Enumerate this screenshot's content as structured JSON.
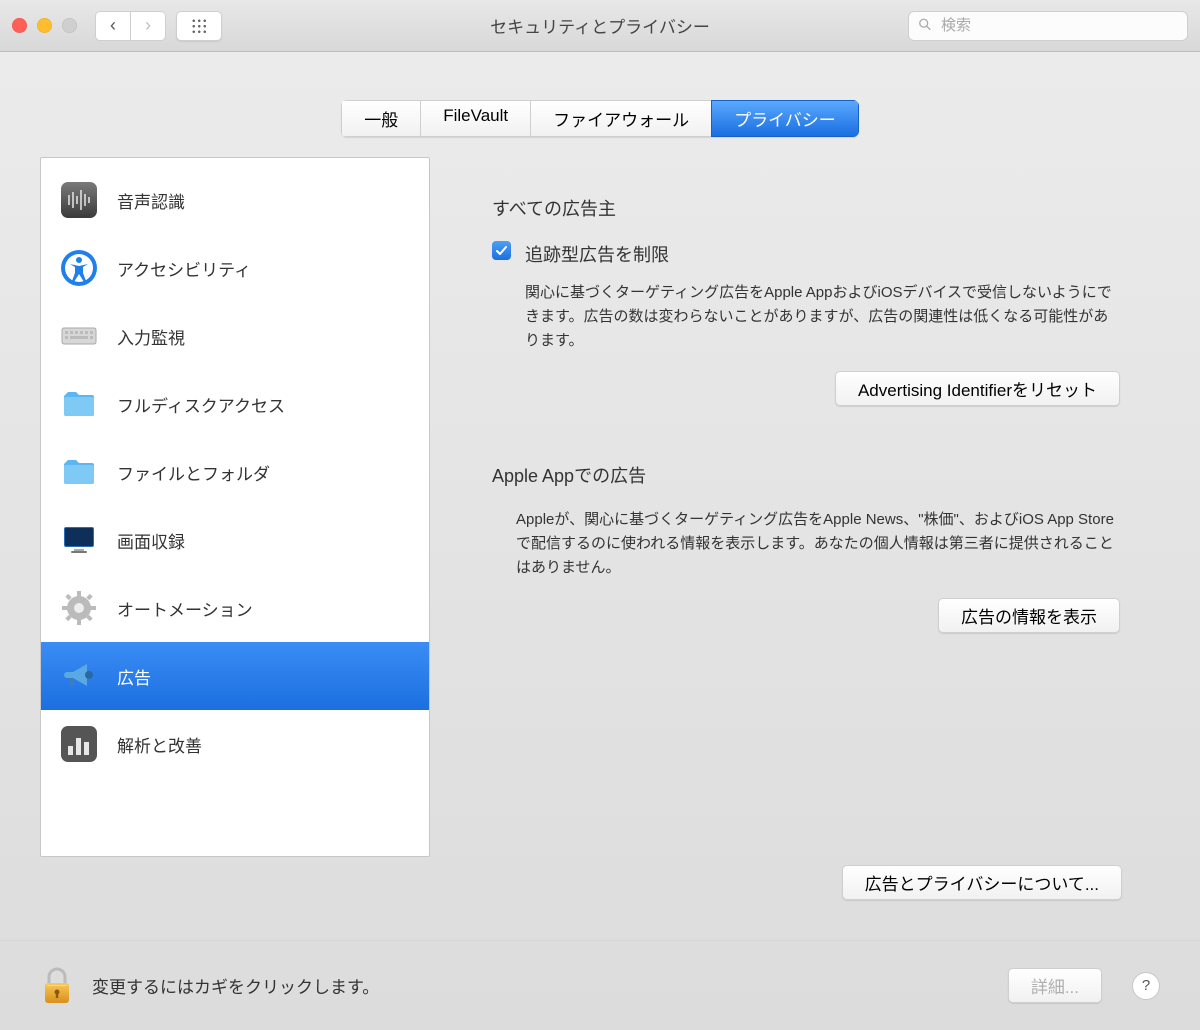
{
  "window": {
    "title": "セキュリティとプライバシー"
  },
  "search": {
    "placeholder": "検索"
  },
  "tabs": [
    {
      "label": "一般"
    },
    {
      "label": "FileVault"
    },
    {
      "label": "ファイアウォール"
    },
    {
      "label": "プライバシー"
    }
  ],
  "sidebar": {
    "items": [
      {
        "label": "音声認識",
        "icon": "speech-icon"
      },
      {
        "label": "アクセシビリティ",
        "icon": "accessibility-icon"
      },
      {
        "label": "入力監視",
        "icon": "keyboard-icon"
      },
      {
        "label": "フルディスクアクセス",
        "icon": "disk-folder-icon"
      },
      {
        "label": "ファイルとフォルダ",
        "icon": "folder-icon"
      },
      {
        "label": "画面収録",
        "icon": "display-icon"
      },
      {
        "label": "オートメーション",
        "icon": "automation-icon"
      },
      {
        "label": "広告",
        "icon": "megaphone-icon"
      },
      {
        "label": "解析と改善",
        "icon": "analytics-icon"
      }
    ],
    "selected_index": 7
  },
  "detail": {
    "section1": {
      "title": "すべての広告主",
      "checkbox_label": "追跡型広告を制限",
      "checkbox_checked": true,
      "description": "関心に基づくターゲティング広告をApple AppおよびiOSデバイスで受信しないようにできます。広告の数は変わらないことがありますが、広告の関連性は低くなる可能性があります。",
      "button": "Advertising Identifierをリセット"
    },
    "section2": {
      "title": "Apple Appでの広告",
      "description": "Appleが、関心に基づくターゲティング広告をApple News、\"株価\"、およびiOS App Storeで配信するのに使われる情報を表示します。あなたの個人情報は第三者に提供されることはありません。",
      "button": "広告の情報を表示"
    },
    "about_button": "広告とプライバシーについて..."
  },
  "footer": {
    "lock_text": "変更するにはカギをクリックします。",
    "advanced_button": "詳細...",
    "help": "?"
  }
}
